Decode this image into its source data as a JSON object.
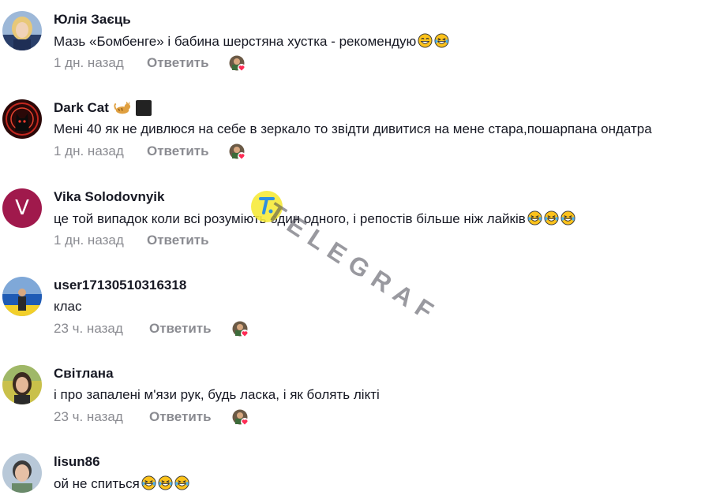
{
  "comments": [
    {
      "username": "Юлія Заєць",
      "text": "Мазь «Бомбенге» і бабина шерстяна хустка - рекомендую",
      "emojis": [
        "grin",
        "laugh"
      ],
      "time": "1 дн. назад",
      "reply_label": "Ответить",
      "avatar": "photo-woman-blonde"
    },
    {
      "username": "Dark Cat",
      "username_icons": [
        "cat-emoji",
        "black-square-emoji"
      ],
      "text": "Мені 40 як не дивлюся на себе в зеркало то звідти дивитися на мене стара,пошарпана ондатра",
      "emojis": [],
      "time": "1 дн. назад",
      "reply_label": "Ответить",
      "avatar": "photo-dark-cat-red"
    },
    {
      "username": "Vika Solodovnyik",
      "text": "це той випадок коли всі розуміють один одного, і репостів більше ніж лайків",
      "emojis": [
        "laugh",
        "laugh",
        "laugh"
      ],
      "time": "1 дн. назад",
      "reply_label": "Ответить",
      "avatar": "letter",
      "avatar_letter": "V"
    },
    {
      "username": "user17130510316318",
      "text": "клас",
      "emojis": [],
      "time": "23 ч. назад",
      "reply_label": "Ответить",
      "avatar": "photo-ukraine-flag"
    },
    {
      "username": "Світлана",
      "text": "і про запалені м'язи рук, будь ласка, і як болять лікті",
      "emojis": [],
      "time": "23 ч. назад",
      "reply_label": "Ответить",
      "avatar": "photo-woman-dark-hair"
    },
    {
      "username": "lisun86",
      "text": "ой не спиться",
      "emojis": [
        "laugh",
        "laugh",
        "laugh"
      ],
      "time": "",
      "reply_label": "",
      "avatar": "photo-woman-short-hair"
    }
  ],
  "watermark": {
    "text": "TELEGRAF",
    "logo": "telegraf-logo-icon"
  },
  "colors": {
    "meta": "#8a8b91",
    "text": "#161823",
    "like_heart": "#fe2c55",
    "letter_avatar": "#a0194c"
  }
}
